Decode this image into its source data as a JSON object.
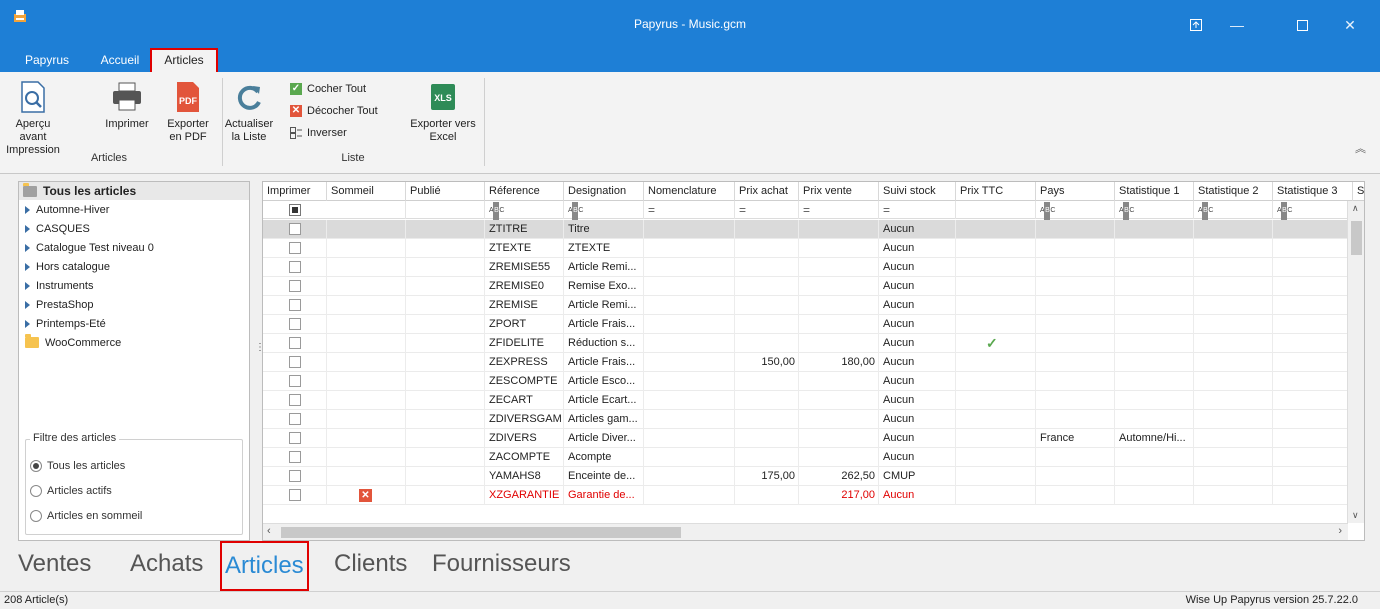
{
  "window": {
    "title": "Papyrus - Music.gcm"
  },
  "menu": [
    {
      "label": "Papyrus",
      "active": false
    },
    {
      "label": "Accueil",
      "active": false
    },
    {
      "label": "Articles",
      "active": true
    }
  ],
  "ribbon": {
    "apercu": "Aperçu avant Impression",
    "imprimer": "Imprimer",
    "exporter_pdf": "Exporter en PDF",
    "group_articles": "Articles",
    "actualiser": "Actualiser la Liste",
    "cocher_tout": "Cocher Tout",
    "decocher_tout": "Décocher Tout",
    "inverser": "Inverser",
    "exporter_excel": "Exporter vers Excel",
    "group_liste": "Liste",
    "pdf_badge": "PDF",
    "xls_badge": "XLS"
  },
  "tree": {
    "root": "Tous les articles",
    "items": [
      "Automne-Hiver",
      "CASQUES",
      "Catalogue Test niveau 0",
      "Hors catalogue",
      "Instruments",
      "PrestaShop",
      "Printemps-Eté",
      "WooCommerce"
    ]
  },
  "filter": {
    "title": "Filtre des articles",
    "options": [
      {
        "label": "Tous les articles",
        "selected": true
      },
      {
        "label": "Articles actifs",
        "selected": false
      },
      {
        "label": "Articles en sommeil",
        "selected": false
      }
    ]
  },
  "grid": {
    "columns": [
      "Imprimer",
      "Sommeil",
      "Publié",
      "Réference",
      "Designation",
      "Nomenclature",
      "Prix achat",
      "Prix vente",
      "Suivi stock",
      "Prix TTC",
      "Pays",
      "Statistique 1",
      "Statistique 2",
      "Statistique 3",
      "S"
    ],
    "filter_row": [
      "",
      "",
      "",
      "ABC",
      "ABC",
      "=",
      "=",
      "=",
      "=",
      "",
      "ABC",
      "ABC",
      "ABC",
      "ABC"
    ],
    "rows": [
      {
        "ref": "ZTITRE",
        "des": "Titre",
        "pa": "",
        "pv": "",
        "stock": "Aucun",
        "ttc": false,
        "pays": "",
        "stat1": "",
        "sommeil": false,
        "red": false,
        "selected": true
      },
      {
        "ref": "ZTEXTE",
        "des": "ZTEXTE",
        "pa": "",
        "pv": "",
        "stock": "Aucun",
        "ttc": false,
        "pays": "",
        "stat1": "",
        "sommeil": false,
        "red": false
      },
      {
        "ref": "ZREMISE55",
        "des": "Article Remi...",
        "pa": "",
        "pv": "",
        "stock": "Aucun",
        "ttc": false,
        "pays": "",
        "stat1": "",
        "sommeil": false,
        "red": false
      },
      {
        "ref": "ZREMISE0",
        "des": "Remise Exo...",
        "pa": "",
        "pv": "",
        "stock": "Aucun",
        "ttc": false,
        "pays": "",
        "stat1": "",
        "sommeil": false,
        "red": false
      },
      {
        "ref": "ZREMISE",
        "des": "Article Remi...",
        "pa": "",
        "pv": "",
        "stock": "Aucun",
        "ttc": false,
        "pays": "",
        "stat1": "",
        "sommeil": false,
        "red": false
      },
      {
        "ref": "ZPORT",
        "des": "Article Frais...",
        "pa": "",
        "pv": "",
        "stock": "Aucun",
        "ttc": false,
        "pays": "",
        "stat1": "",
        "sommeil": false,
        "red": false
      },
      {
        "ref": "ZFIDELITE",
        "des": "Réduction s...",
        "pa": "",
        "pv": "",
        "stock": "Aucun",
        "ttc": true,
        "pays": "",
        "stat1": "",
        "sommeil": false,
        "red": false
      },
      {
        "ref": "ZEXPRESS",
        "des": "Article Frais...",
        "pa": "150,00",
        "pv": "180,00",
        "stock": "Aucun",
        "ttc": false,
        "pays": "",
        "stat1": "",
        "sommeil": false,
        "red": false
      },
      {
        "ref": "ZESCOMPTE",
        "des": "Article Esco...",
        "pa": "",
        "pv": "",
        "stock": "Aucun",
        "ttc": false,
        "pays": "",
        "stat1": "",
        "sommeil": false,
        "red": false
      },
      {
        "ref": "ZECART",
        "des": "Article Ecart...",
        "pa": "",
        "pv": "",
        "stock": "Aucun",
        "ttc": false,
        "pays": "",
        "stat1": "",
        "sommeil": false,
        "red": false
      },
      {
        "ref": "ZDIVERSGAM",
        "des": "Articles gam...",
        "pa": "",
        "pv": "",
        "stock": "Aucun",
        "ttc": false,
        "pays": "",
        "stat1": "",
        "sommeil": false,
        "red": false
      },
      {
        "ref": "ZDIVERS",
        "des": "Article Diver...",
        "pa": "",
        "pv": "",
        "stock": "Aucun",
        "ttc": false,
        "pays": "France",
        "stat1": "Automne/Hi...",
        "sommeil": false,
        "red": false
      },
      {
        "ref": "ZACOMPTE",
        "des": "Acompte",
        "pa": "",
        "pv": "",
        "stock": "Aucun",
        "ttc": false,
        "pays": "",
        "stat1": "",
        "sommeil": false,
        "red": false
      },
      {
        "ref": "YAMAHS8",
        "des": "Enceinte de...",
        "pa": "175,00",
        "pv": "262,50",
        "stock": "CMUP",
        "ttc": false,
        "pays": "",
        "stat1": "",
        "sommeil": false,
        "red": false
      },
      {
        "ref": "XZGARANTIE",
        "des": "Garantie de...",
        "pa": "",
        "pv": "217,00",
        "stock": "Aucun",
        "ttc": false,
        "pays": "",
        "stat1": "",
        "sommeil": true,
        "red": true
      }
    ]
  },
  "nav": [
    {
      "label": "Ventes",
      "active": false
    },
    {
      "label": "Achats",
      "active": false
    },
    {
      "label": "Articles",
      "active": true
    },
    {
      "label": "Clients",
      "active": false
    },
    {
      "label": "Fournisseurs",
      "active": false
    }
  ],
  "status": {
    "count": "208 Article(s)",
    "version": "Wise Up Papyrus version 25.7.22.0"
  },
  "colors": {
    "titlebar": "#1e7fd6",
    "highlight": "#e00000",
    "nav_active": "#2a8ad4"
  }
}
